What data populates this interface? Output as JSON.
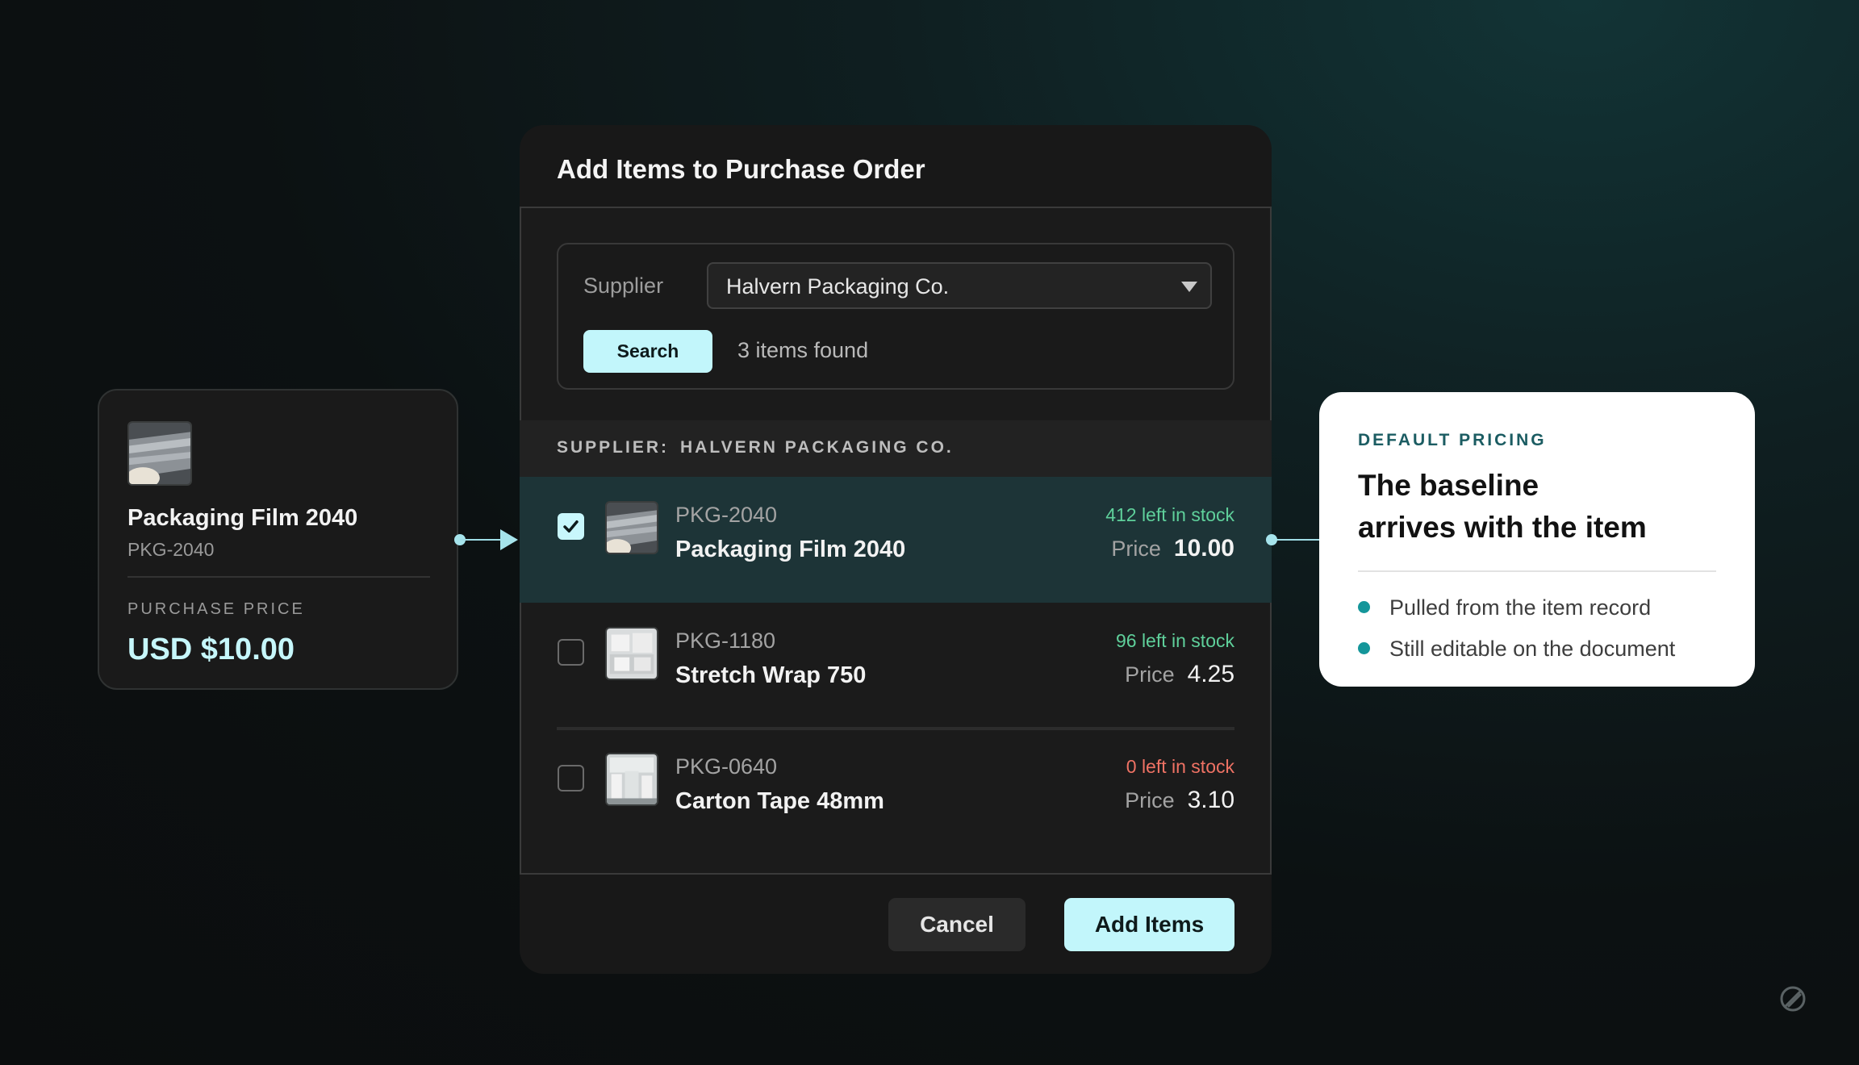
{
  "left_card": {
    "title": "Packaging Film 2040",
    "code": "PKG-2040",
    "price_label": "PURCHASE PRICE",
    "price_value": "USD $10.00",
    "thumbnail_icon": "film-roll-image"
  },
  "modal": {
    "title": "Add Items to Purchase Order",
    "supplier_label": "Supplier",
    "supplier_value": "Halvern Packaging Co.",
    "search_button": "Search",
    "results_count": "3 items found",
    "group_label": "SUPPLIER:",
    "group_value": "HALVERN PACKAGING CO.",
    "items": [
      {
        "sku": "PKG-2040",
        "name": "Packaging Film 2040",
        "stock": "412 left in stock",
        "price_label": "Price",
        "price": "10.00",
        "checked": true,
        "stock_status": "in"
      },
      {
        "sku": "PKG-1180",
        "name": "Stretch Wrap 750",
        "stock": "96 left in stock",
        "price_label": "Price",
        "price": "4.25",
        "checked": false,
        "stock_status": "in"
      },
      {
        "sku": "PKG-0640",
        "name": "Carton Tape 48mm",
        "stock": "0 left in stock",
        "price_label": "Price",
        "price": "3.10",
        "checked": false,
        "stock_status": "out"
      }
    ],
    "cancel_button": "Cancel",
    "add_button": "Add Items"
  },
  "right_card": {
    "eyebrow": "DEFAULT PRICING",
    "headline_line1": "The baseline",
    "headline_line2": "arrives with the item",
    "bullets": [
      "Pulled from the item record",
      "Still editable on the document"
    ]
  },
  "colors": {
    "accent": "#c2f6fb",
    "selected_row": "#1d3437",
    "in_stock": "#5fd09b",
    "out_of_stock": "#ef7264",
    "bullet": "#14969a"
  }
}
